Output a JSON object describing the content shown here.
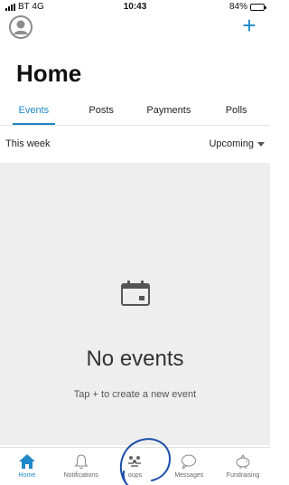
{
  "status_bar": {
    "carrier": "BT 4G",
    "time": "10:43",
    "battery": "84%",
    "battery_level": 0.84
  },
  "header": {
    "avatar_icon": "person-icon",
    "add_icon": "plus-icon",
    "add_label": "+",
    "title": "Home"
  },
  "tabs": [
    {
      "label": "Events",
      "active": true
    },
    {
      "label": "Posts",
      "active": false
    },
    {
      "label": "Payments",
      "active": false
    },
    {
      "label": "Polls",
      "active": false
    }
  ],
  "filter": {
    "period": "This week",
    "sort": "Upcoming"
  },
  "empty_state": {
    "icon": "calendar-icon",
    "title": "No events",
    "subtitle": "Tap + to create a new event"
  },
  "bottom_nav": [
    {
      "label": "Home",
      "icon": "home-icon",
      "active": true
    },
    {
      "label": "Notifications",
      "icon": "bell-icon",
      "active": false
    },
    {
      "label": "oups",
      "icon": "groups-icon",
      "active": false
    },
    {
      "label": "Messages",
      "icon": "speech-bubble-icon",
      "active": false
    },
    {
      "label": "Fundraising",
      "icon": "piggy-bank-icon",
      "active": false
    }
  ],
  "colors": {
    "accent": "#1e88c8",
    "annotation": "#1b4fa8",
    "empty_background": "#eeeeee"
  }
}
